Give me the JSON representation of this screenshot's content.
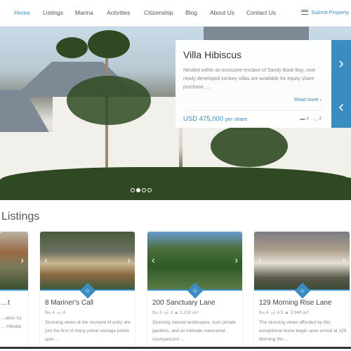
{
  "nav": {
    "items": [
      "Home",
      "Listings",
      "Marina",
      "Activities",
      "Citizenship",
      "Blog",
      "About Us",
      "Contact Us"
    ],
    "active": "Home",
    "submit": "Submit Property"
  },
  "hero": {
    "title": "Villa Hibiscus",
    "description": "Nestled within an exclusive enclave of Sandy Bank Bay, nine newly developed turnkey villas are available for equity share purchase. ...",
    "read_more": "Read more ›",
    "price": "USD 475,000",
    "price_unit": "per share",
    "beds": "4",
    "baths": "4",
    "next": "›",
    "prev": "‹",
    "slide_count": 4,
    "active_slide": 2
  },
  "section": {
    "title": "Listings"
  },
  "listings": [
    {
      "title": "…t",
      "specs": "",
      "description": "…ation for … Hillside"
    },
    {
      "title": "8 Mariner's Call",
      "specs": "🛏 4  🛁 4",
      "description": "Stunning views at the moment of entry are just the first of many prime vantage points spre ..."
    },
    {
      "title": "200 Sanctuary Lane",
      "specs": "🛏 3  🛁 3  ▲ 3,230 ac²",
      "description": "Stunning natural landscapes, lush private gardens, and an intimate manicured courtyard pro ..."
    },
    {
      "title": "129 Morning Rise Lane",
      "specs": "🛏 4  🛁 4.5  ▲ 3,948 ac²",
      "description": "The stunning views afforded by this exceptional home begin upon arrival at 129 Morning Ris ..."
    }
  ],
  "colors": {
    "accent": "#3a8cc1"
  }
}
